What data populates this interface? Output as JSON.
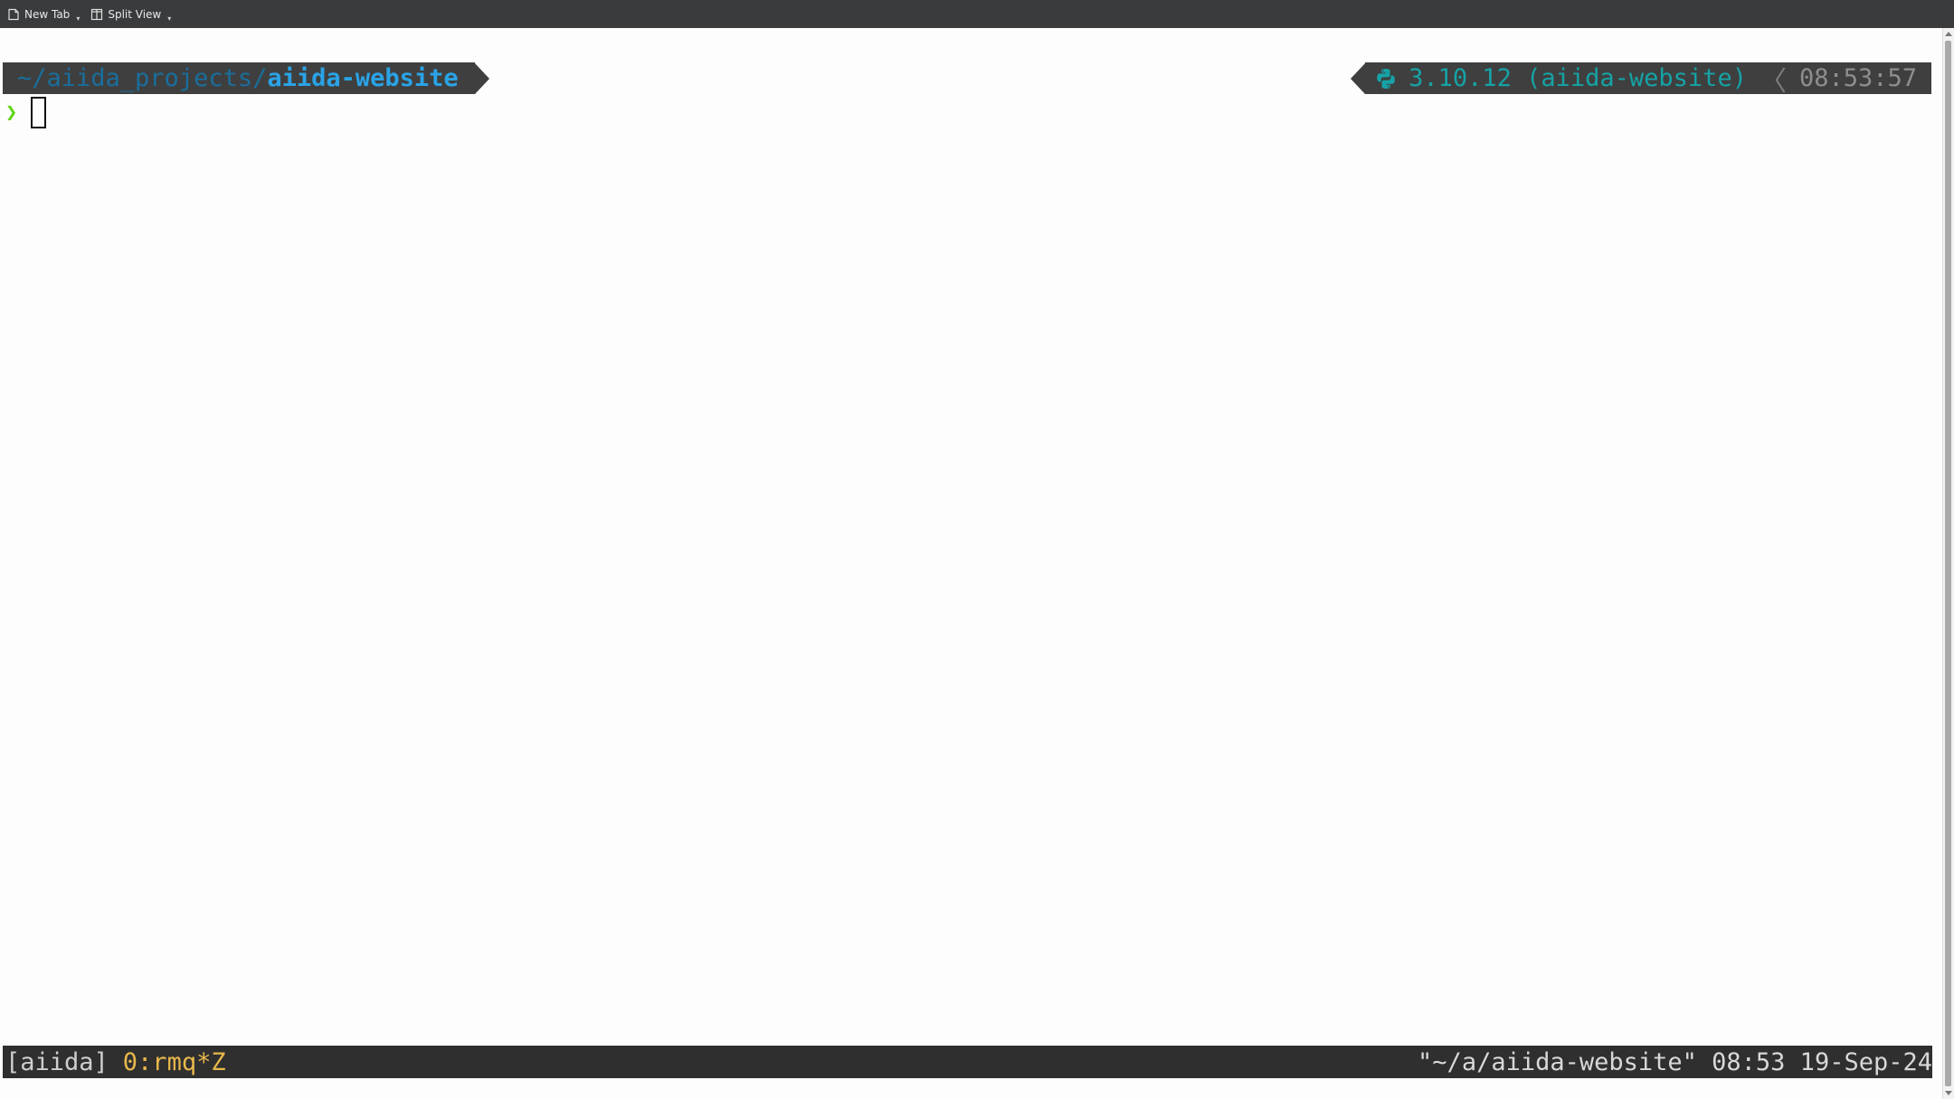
{
  "toolbar": {
    "new_tab_label": "New Tab",
    "split_view_label": "Split View"
  },
  "prompt": {
    "path_dim": "~/aiida_projects/",
    "path_bright": "aiida-website",
    "python_info": "3.10.12 (aiida-website)",
    "time": "08:53:57",
    "prompt_char": "❯"
  },
  "status_bar": {
    "session": "[aiida]",
    "window": "0:rmq*Z",
    "right_text": "\"~/a/aiida-website\" 08:53 19-Sep-24"
  },
  "colors": {
    "path_dim": "#1a6e9c",
    "path_bright": "#2aa3e6",
    "python": "#16a2a5",
    "prompt_char": "#5fd414",
    "window_label": "#e8b84a",
    "segment_bg": "#3f3f3f",
    "status_bg": "#2f2f2f"
  }
}
